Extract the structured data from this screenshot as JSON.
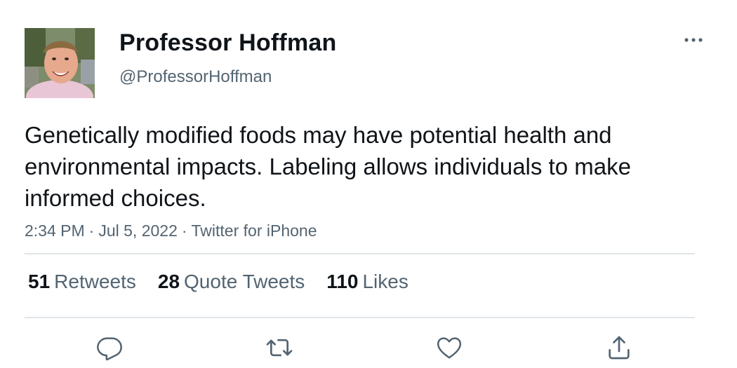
{
  "author": {
    "display_name": "Professor Hoffman",
    "handle": "@ProfessorHoffman"
  },
  "tweet": {
    "text": "Genetically modified foods may have potential health and environmental impacts. Labeling allows individuals to make informed choices.",
    "time": "2:34 PM",
    "date": "Jul 5, 2022",
    "source": "Twitter for iPhone",
    "separator": "·"
  },
  "stats": {
    "retweets_count": "51",
    "retweets_label": "Retweets",
    "quotes_count": "28",
    "quotes_label": "Quote Tweets",
    "likes_count": "110",
    "likes_label": "Likes"
  },
  "icons": {
    "more": "more-horizontal-icon",
    "reply": "reply-icon",
    "retweet": "retweet-icon",
    "like": "heart-icon",
    "share": "share-icon"
  },
  "colors": {
    "text_primary": "#0f1419",
    "text_secondary": "#536471",
    "divider": "#e1e5e8"
  }
}
